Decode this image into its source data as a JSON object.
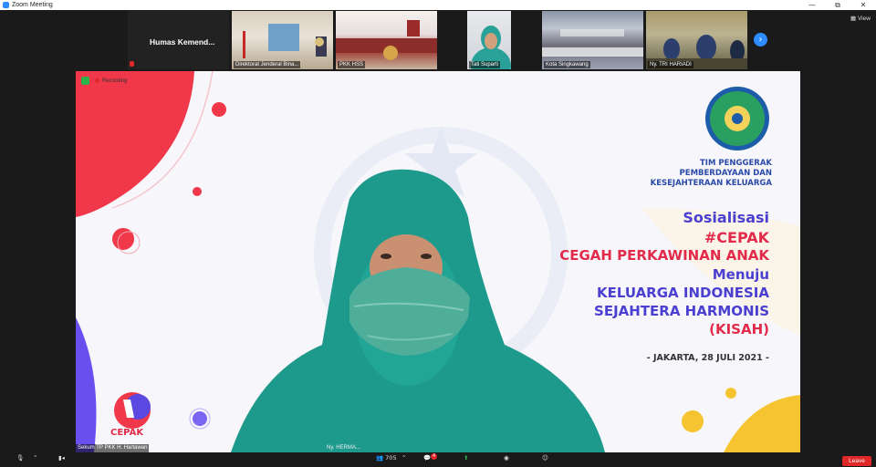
{
  "window": {
    "title": "Zoom Meeting",
    "controls": [
      "—",
      "⧉",
      "✕"
    ]
  },
  "view_button": "View",
  "thumbnails": [
    {
      "name": "Humas  Kemend..."
    },
    {
      "name": "Direktorat Jenderal Bina..."
    },
    {
      "name": "PKK HSS"
    },
    {
      "name": "Tati Suparti"
    },
    {
      "name": "Kota Singkawang"
    },
    {
      "name": "Ny. TRI HARIADI"
    }
  ],
  "next_arrow": "›",
  "recording_label": "Recording",
  "slide": {
    "org_lines": [
      "TIM PENGGERAK",
      "PEMBERDAYAAN DAN",
      "KESEJAHTERAAN KELUARGA"
    ],
    "sosialisasi": "Sosialisasi",
    "hashtag": "#CEPAK",
    "cegah": "CEGAH PERKAWINAN ANAK",
    "menuju": "Menuju",
    "keluarga": "KELUARGA INDONESIA",
    "sejahtera": "SEJAHTERA HARMONIS",
    "kisah": "(KISAH)",
    "date": "- JAKARTA, 28 JULI 2021 -",
    "logo_text": "CEPAK",
    "nametag": "Ny. HERMA..."
  },
  "speaker_label": "Sekum TP PKK H. Hartawan",
  "toolbar": {
    "participants_count": "705",
    "chat_badge": "4",
    "leave": "Leave"
  },
  "colors": {
    "brand_blue": "#2d8cff",
    "leave_red": "#e02828",
    "slide_purple": "#4a3fd0",
    "slide_red": "#e22a4a"
  }
}
